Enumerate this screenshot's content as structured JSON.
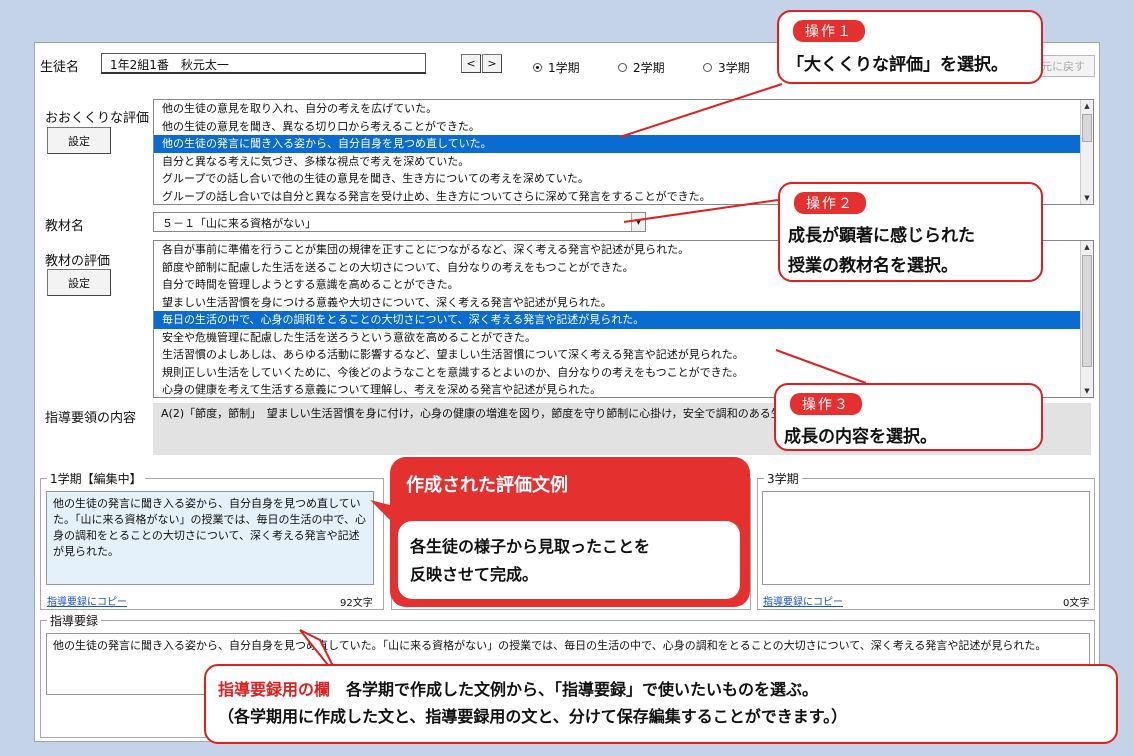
{
  "header": {
    "student_label": "生徒名",
    "student_value": "1年2組1番　秋元太一",
    "prev": "<",
    "next": ">",
    "terms": [
      "1学期",
      "2学期",
      "3学期"
    ],
    "selected_term": 0,
    "restore": "元に戻す"
  },
  "broad": {
    "label": "おおくくりな評価",
    "button": "設定",
    "items": [
      "他の生徒の意見を取り入れ、自分の考えを広げていた。",
      "他の生徒の意見を聞き、異なる切り口から考えることができた。",
      "他の生徒の発言に聞き入る姿から、自分自身を見つめ直していた。",
      "自分と異なる考えに気づき、多様な視点で考えを深めていた。",
      "グループでの話し合いで他の生徒の意見を聞き、生き方についての考えを深めていた。",
      "グループの話し合いでは自分と異なる発言を受け止め、生き方についてさらに深めて発言をすることができた。"
    ],
    "selected": 2
  },
  "material": {
    "label": "教材名",
    "value": "５－１「山に来る資格がない」"
  },
  "material_eval": {
    "label": "教材の評価",
    "button": "設定",
    "items": [
      "各自が事前に準備を行うことが集団の規律を正すことにつながるなど、深く考える発言や記述が見られた。",
      "節度や節制に配慮した生活を送ることの大切さについて、自分なりの考えをもつことができた。",
      "自分で時間を管理しようとする意識を高めることができた。",
      "望ましい生活習慣を身につける意義や大切さについて、深く考える発言や記述が見られた。",
      "毎日の生活の中で、心身の調和をとることの大切さについて、深く考える発言や記述が見られた。",
      "安全や危機管理に配慮した生活を送ろうという意欲を高めることができた。",
      "生活習慣のよしあしは、あらゆる活動に影響するなど、望ましい生活習慣について深く考える発言や記述が見られた。",
      "規則正しい生活をしていくために、今後どのようなことを意識するとよいのか、自分なりの考えをもつことができた。",
      "心身の健康を考えて生活する意義について理解し、考えを深める発言や記述が見られた。"
    ],
    "selected": 4
  },
  "guideline": {
    "label": "指導要領の内容",
    "text": "A(2)「節度，節制」　望ましい生活習慣を身に付け，心身の健康の増進を図り，節度を守り節制に心掛け，安全で調和のある生活をすること。"
  },
  "term1": {
    "title": "1学期【編集中】",
    "text": "他の生徒の発言に聞き入る姿から、自分自身を見つめ直していた。「山に来る資格がない」の授業では、毎日の生活の中で、心身の調和をとることの大切さについて、深く考える発言や記述が見られた。",
    "copy": "指導要録にコピー",
    "count": "92文字"
  },
  "term3": {
    "title": "3学期",
    "text": "",
    "copy": "指導要録にコピー",
    "count": "0文字"
  },
  "record": {
    "title": "指導要録",
    "text": "他の生徒の発言に聞き入る姿から、自分自身を見つめ直していた。「山に来る資格がない」の授業では、毎日の生活の中で、心身の調和をとることの大切さについて、深く考える発言や記述が見られた。"
  },
  "callouts": {
    "op1_badge": "操作１",
    "op1_text": "「大くくりな評価」を選択。",
    "op2_badge": "操作２",
    "op2_line1": "成長が顕著に感じられた",
    "op2_line2": "授業の教材名を選択。",
    "op3_badge": "操作３",
    "op3_text": "成長の内容を選択。",
    "sample_title": "作成された評価文例",
    "sample_line1": "各生徒の様子から見取ったことを",
    "sample_line2": "反映させて完成。",
    "record_red": "指導要録用の欄",
    "record_line1": "　各学期で作成した文例から、「指導要録」で使いたいものを選ぶ。",
    "record_line2": "（各学期用に作成した文と、指導要録用の文と、分けて保存編集することができます。）"
  },
  "colors": {
    "accent_red": "#e53030",
    "selection_blue": "#0a6cd0",
    "term1_bg": "#e4f1fb"
  }
}
